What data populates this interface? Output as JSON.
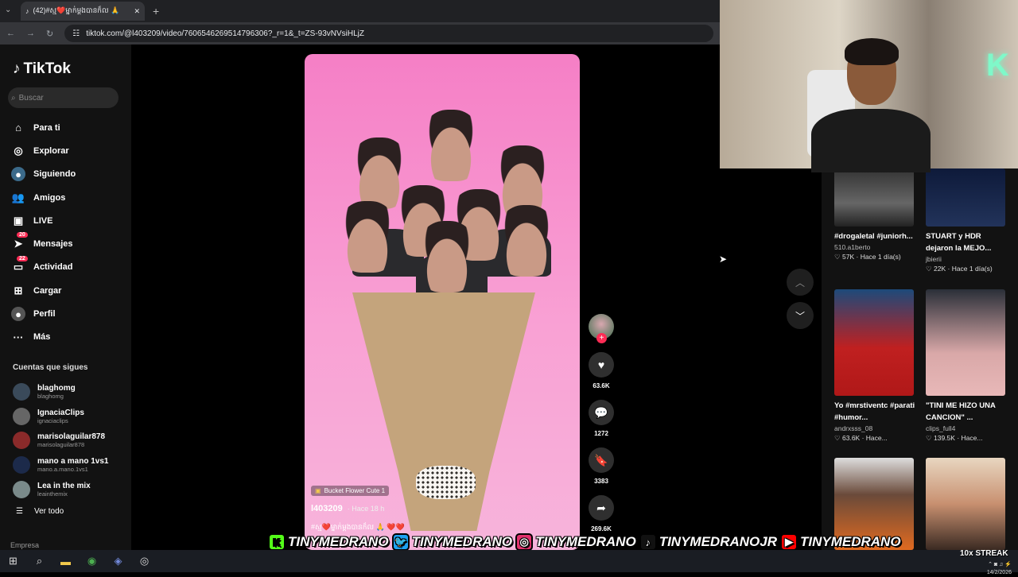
{
  "browser": {
    "tab_title": "(42)#ស្ម❤️ម្នាក់ម្ដងបានក៏ល 🙏",
    "new_tab": "+",
    "url": "tiktok.com/@l403209/video/7606546269514796306?_r=1&_t=ZS-93vNVsiHLjZ"
  },
  "sidebar": {
    "logo": "TikTok",
    "search_placeholder": "Buscar",
    "nav": [
      {
        "label": "Para ti",
        "icon": "home-icon"
      },
      {
        "label": "Explorar",
        "icon": "compass-icon"
      },
      {
        "label": "Siguiendo",
        "icon": "following-icon"
      },
      {
        "label": "Amigos",
        "icon": "friends-icon"
      },
      {
        "label": "LIVE",
        "icon": "live-icon"
      },
      {
        "label": "Mensajes",
        "icon": "messages-icon",
        "badge": "20"
      },
      {
        "label": "Actividad",
        "icon": "activity-icon",
        "badge": "22"
      },
      {
        "label": "Cargar",
        "icon": "upload-icon"
      },
      {
        "label": "Perfil",
        "icon": "profile-icon"
      },
      {
        "label": "Más",
        "icon": "more-icon"
      }
    ],
    "following_title": "Cuentas que sigues",
    "following": [
      {
        "name": "blaghomg",
        "handle": "blaghomg"
      },
      {
        "name": "IgnaciaClips",
        "handle": "ignaciaclips"
      },
      {
        "name": "marisolaguilar878",
        "handle": "marisolaguilar878"
      },
      {
        "name": "mano a mano 1vs1",
        "handle": "mano.a.mano.1vs1"
      },
      {
        "name": "Lea in the mix",
        "handle": "leainthemix"
      }
    ],
    "see_all": "Ver todo",
    "business": "Empresa"
  },
  "video": {
    "effect": "Bucket Flower Cute 1",
    "author": "l403209",
    "time": "· Hace 18 h",
    "caption": "#ស្ម❤️ម្នាក់ម្ដងបានក៏ល 🙏 ❤️❤️",
    "likes": "63.6K",
    "comments": "1272",
    "saves": "3383",
    "shares": "269.6K"
  },
  "recommended": [
    {
      "title": "#drogaletal #juniorh...",
      "user": "510.a1berto",
      "likes": "57K",
      "time": "Hace 1 día(s)"
    },
    {
      "title": "STUART y HDR dejaron la MEJO...",
      "user": "jbierii",
      "likes": "22K",
      "time": "Hace 1 día(s)"
    },
    {
      "title": "Yo #mrstiventc #parati #humor...",
      "user": "andrxsss_08",
      "likes": "63.6K",
      "time": "Hace..."
    },
    {
      "title": "\"TINI ME HIZO UNA CANCION\" ...",
      "user": "clips_full4",
      "likes": "139.5K",
      "time": "Hace..."
    }
  ],
  "overlay": [
    {
      "name": "TINYMEDRANO",
      "icon": "kick-icon",
      "color": "#53fc18",
      "glyph": "K"
    },
    {
      "name": "TINYMEDRANO",
      "icon": "twitter-icon",
      "color": "#1da1f2",
      "glyph": "🐦"
    },
    {
      "name": "TINYMEDRANO",
      "icon": "instagram-icon",
      "color": "#e1306c",
      "glyph": "◎"
    },
    {
      "name": "TINYMEDRANOJR",
      "icon": "tiktok-icon",
      "color": "#111111",
      "glyph": "♪"
    },
    {
      "name": "TINYMEDRANO",
      "icon": "youtube-icon",
      "color": "#ff0000",
      "glyph": "▶"
    }
  ],
  "taskbar": {
    "streak": "10x STREAK",
    "date": "14/2/2026"
  }
}
